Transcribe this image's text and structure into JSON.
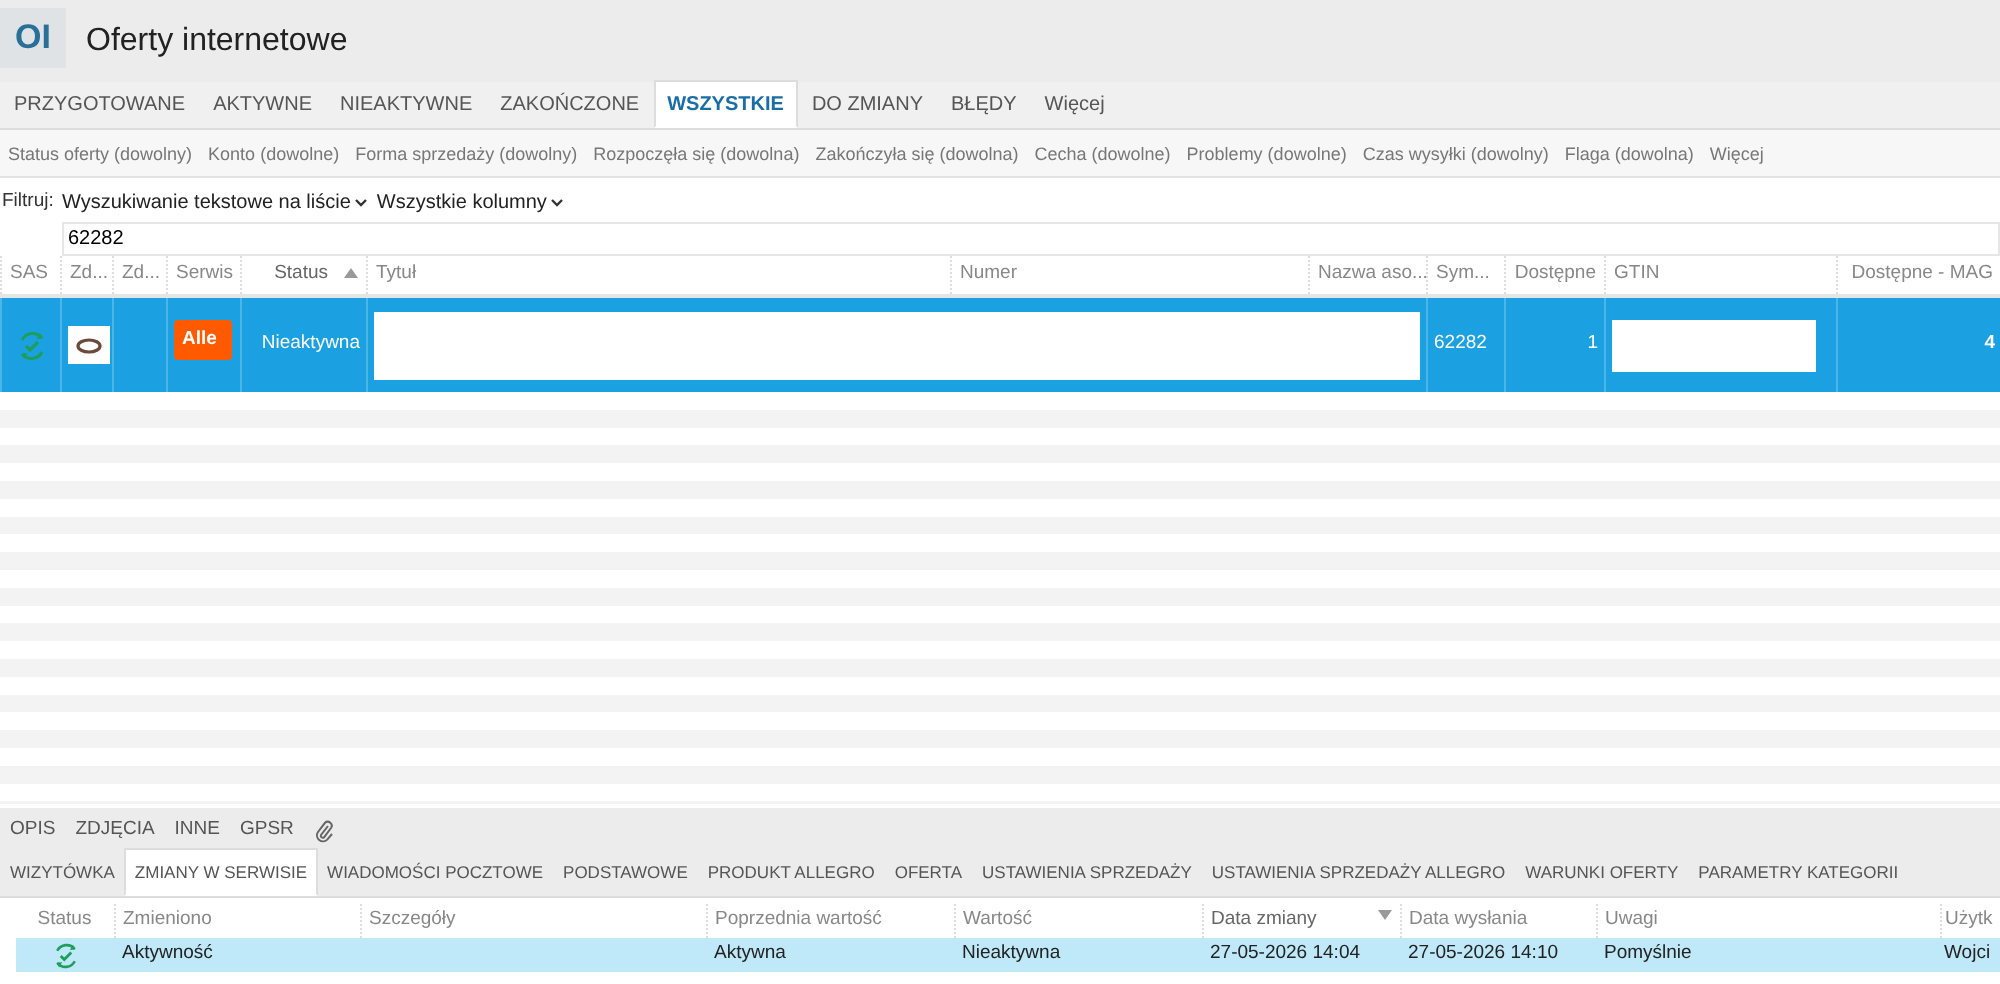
{
  "header": {
    "badge": "OI",
    "title": "Oferty internetowe"
  },
  "tabs": [
    {
      "label": "PRZYGOTOWANE",
      "selected": false
    },
    {
      "label": "AKTYWNE",
      "selected": false
    },
    {
      "label": "NIEAKTYWNE",
      "selected": false
    },
    {
      "label": "ZAKOŃCZONE",
      "selected": false
    },
    {
      "label": "WSZYSTKIE",
      "selected": true
    },
    {
      "label": "DO ZMIANY",
      "selected": false
    },
    {
      "label": "BŁĘDY",
      "selected": false
    },
    {
      "label": "Więcej",
      "selected": false
    }
  ],
  "filter_chips": [
    "Status oferty (dowolny)",
    "Konto (dowolne)",
    "Forma sprzedaży (dowolny)",
    "Rozpoczęła się (dowolna)",
    "Zakończyła się (dowolna)",
    "Cecha (dowolne)",
    "Problemy (dowolne)",
    "Czas wysyłki (dowolny)",
    "Flaga (dowolna)",
    "Więcej"
  ],
  "filter": {
    "label": "Filtruj:",
    "mode": "Wyszukiwanie tekstowe na liście",
    "columns": "Wszystkie kolumny",
    "value": "62282"
  },
  "table": {
    "sort_descending": false,
    "columns": [
      {
        "label": "SAS",
        "sorted": false
      },
      {
        "label": "Zd...",
        "sorted": false
      },
      {
        "label": "Zd...",
        "sorted": false
      },
      {
        "label": "Serwis",
        "sorted": false
      },
      {
        "label": "Status",
        "sorted": true
      },
      {
        "label": "Tytuł",
        "sorted": false
      },
      {
        "label": "Numer",
        "sorted": false
      },
      {
        "label": "Nazwa aso...",
        "sorted": false
      },
      {
        "label": "Sym...",
        "sorted": false
      },
      {
        "label": "Dostępne",
        "sorted": false
      },
      {
        "label": "GTIN",
        "sorted": false
      },
      {
        "label": "Dostępne - MAG",
        "sorted": false
      }
    ],
    "rows": [
      {
        "selected": true,
        "service": "Alle",
        "status": "Nieaktywna",
        "symbol": "62282",
        "available": "1",
        "available_mag": "4"
      }
    ]
  },
  "bottom_tabs": [
    {
      "label": "OPIS",
      "kind": "text"
    },
    {
      "label": "ZDJĘCIA",
      "kind": "text"
    },
    {
      "label": "INNE",
      "kind": "text"
    },
    {
      "label": "GPSR",
      "kind": "text"
    },
    {
      "kind": "attachment"
    }
  ],
  "detail_tabs": [
    {
      "label": "WIZYTÓWKA",
      "selected": false
    },
    {
      "label": "ZMIANY W SERWISIE",
      "selected": true
    },
    {
      "label": "WIADOMOŚCI POCZTOWE",
      "selected": false
    },
    {
      "label": "PODSTAWOWE",
      "selected": false
    },
    {
      "label": "PRODUKT ALLEGRO",
      "selected": false
    },
    {
      "label": "OFERTA",
      "selected": false
    },
    {
      "label": "USTAWIENIA SPRZEDAŻY",
      "selected": false
    },
    {
      "label": "USTAWIENIA SPRZEDAŻY ALLEGRO",
      "selected": false
    },
    {
      "label": "WARUNKI OFERTY",
      "selected": false
    },
    {
      "label": "PARAMETRY KATEGORII",
      "selected": false
    }
  ],
  "changes": {
    "sort_descending": true,
    "columns": [
      {
        "label": "Status",
        "sorted": false
      },
      {
        "label": "Zmieniono",
        "sorted": false
      },
      {
        "label": "Szczegóły",
        "sorted": false
      },
      {
        "label": "Poprzednia wartość",
        "sorted": false
      },
      {
        "label": "Wartość",
        "sorted": false
      },
      {
        "label": "Data zmiany",
        "sorted": true
      },
      {
        "label": "Data wysłania",
        "sorted": false
      },
      {
        "label": "Uwagi",
        "sorted": false
      },
      {
        "label": "Użytk",
        "sorted": false
      }
    ],
    "rows": [
      {
        "selected": true,
        "changed": "Aktywność",
        "previous": "Aktywna",
        "value": "Nieaktywna",
        "changed_at": "27-05-2026 14:04",
        "sent_at": "27-05-2026 14:10",
        "notes": "Pomyślnie",
        "user": "Wojci"
      }
    ]
  }
}
